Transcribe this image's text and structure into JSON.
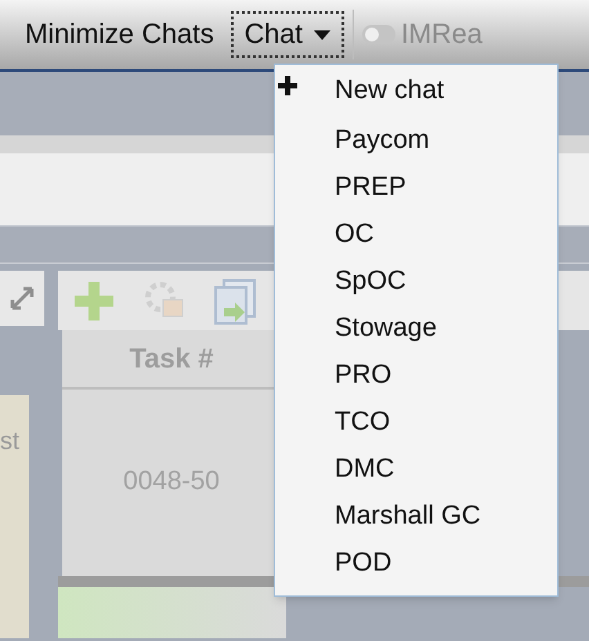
{
  "top_bar": {
    "minimize_button": {
      "label": "Minimize Chats"
    },
    "chat_button": {
      "label": "Chat",
      "expanded": true
    },
    "toggle": {
      "label": "IMRea",
      "on": false,
      "disabled": true
    }
  },
  "chat_menu": {
    "items": [
      {
        "label": "New chat",
        "kind": "action"
      },
      {
        "label": "Paycom",
        "kind": "chat"
      },
      {
        "label": "PREP",
        "kind": "chat"
      },
      {
        "label": "OC",
        "kind": "chat"
      },
      {
        "label": "SpOC",
        "kind": "chat"
      },
      {
        "label": "Stowage",
        "kind": "chat"
      },
      {
        "label": "PRO",
        "kind": "chat"
      },
      {
        "label": "TCO",
        "kind": "chat"
      },
      {
        "label": "DMC",
        "kind": "chat"
      },
      {
        "label": "Marshall GC",
        "kind": "chat"
      },
      {
        "label": "POD",
        "kind": "chat"
      }
    ]
  },
  "left_panel": {
    "column_1": "st"
  },
  "table": {
    "columns": [
      "Task #"
    ],
    "rows": [
      {
        "column_1": "0048-50"
      }
    ]
  }
}
